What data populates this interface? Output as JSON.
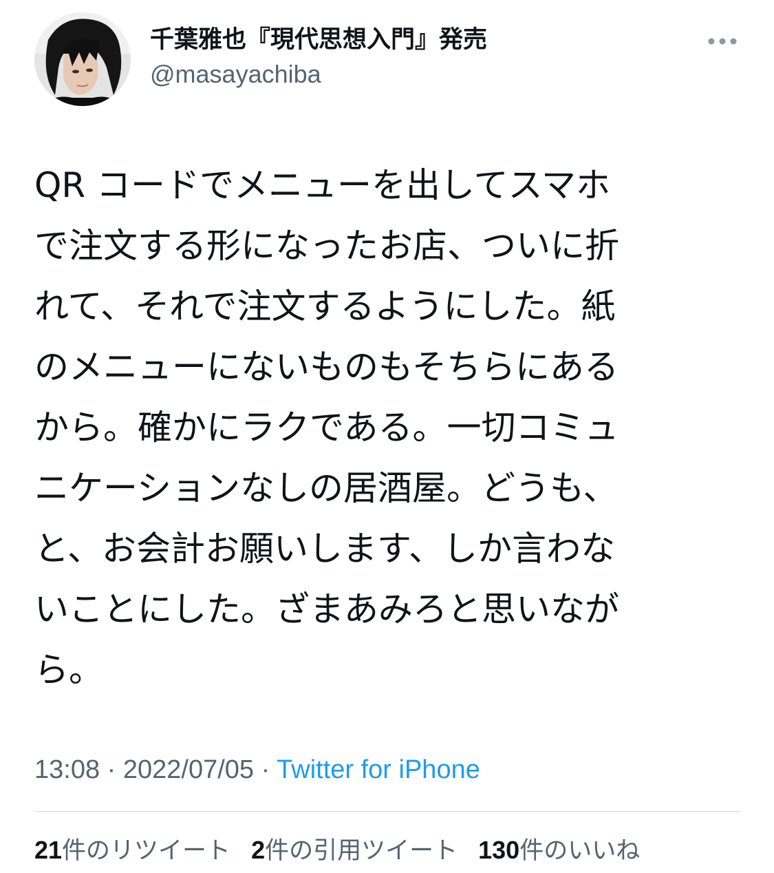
{
  "author": {
    "display_name": "千葉雅也『現代思想入門』発売",
    "handle": "@masayachiba",
    "avatar_icon": "profile-photo"
  },
  "more_icon": "more-horizontal-icon",
  "tweet": {
    "lines": [
      "QR コードでメニューを出してスマホ",
      "で注文する形になったお店、ついに折",
      "れて、それで注文するようにした。紙",
      "のメニューにないものもそちらにある",
      "から。確かにラクである。一切コミュ",
      "ニケーションなしの居酒屋。どうも、",
      "と、お会計お願いします、しか言わな",
      "いことにした。ざまあみろと思いなが",
      "ら。"
    ]
  },
  "meta": {
    "time": "13:08",
    "sep1": " · ",
    "date": "2022/07/05",
    "sep2": " · ",
    "source": "Twitter for iPhone"
  },
  "stats": {
    "retweets_count": "21",
    "retweets_label": "件のリツイート",
    "quotes_count": "2",
    "quotes_label": "件の引用ツイート",
    "likes_count": "130",
    "likes_label": "件のいいね"
  },
  "colors": {
    "text": "#0f1419",
    "secondary": "#536471",
    "link": "#1d9bf0",
    "divider": "#cfd9de"
  }
}
